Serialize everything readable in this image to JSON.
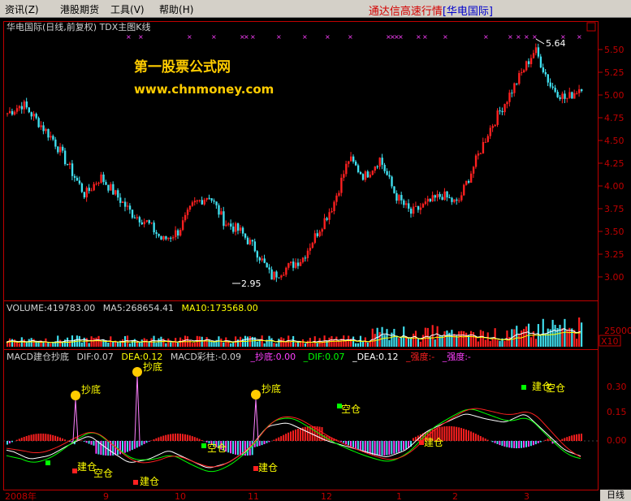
{
  "menu": {
    "items": [
      "资讯",
      "港股期货",
      "工具",
      "帮助"
    ],
    "hotkeys": [
      "(Z)",
      "",
      "(V)",
      "(H)"
    ]
  },
  "app_title": {
    "prefix": "通达信高速行情",
    "stock": "[华电国际]"
  },
  "kline": {
    "header": "华电国际(日线,前复权) TDX主图K线",
    "watermark_line1": "第一股票公式网",
    "watermark_line2": "www.chnmoney.com",
    "high_label": "5.64",
    "low_label": "2.95",
    "y_ticks": [
      "5.50",
      "5.25",
      "5.00",
      "4.75",
      "4.50",
      "4.25",
      "4.00",
      "3.75",
      "3.50",
      "3.25",
      "3.00"
    ]
  },
  "volume": {
    "label_volume": "VOLUME:419783.00",
    "label_ma5": "MA5:268654.41",
    "label_ma10": "MA10:173568.00",
    "y_tick": "25000",
    "unit": "X10"
  },
  "macd": {
    "name": "MACD建仓抄底",
    "dif": "DIF:0.07",
    "dea": "DEA:0.12",
    "macd_bar": "MACD彩柱:-0.09",
    "chaodi": "_抄底:0.00",
    "dif2": "_DIF:0.07",
    "dea2": "_DEA:0.12",
    "qiangdu1": "_强度:-",
    "qiangdu2": "_强度:-",
    "y_ticks": [
      "0.30",
      "0.15",
      "0.00"
    ],
    "signal_chaodi": "抄底",
    "signal_jiancang": "建仓",
    "signal_kongcang": "空仓"
  },
  "time_axis": {
    "labels": [
      "2008年",
      "9",
      "10",
      "11",
      "12",
      "1",
      "2",
      "3"
    ],
    "period": "日线"
  },
  "colors": {
    "up": "#ff2020",
    "down": "#40e0f0",
    "axis": "#c00000",
    "ma5": "#ffffff",
    "ma10": "#ffff00",
    "dif": "#ffffff",
    "dea": "#00ff00",
    "signal": "#ffff00"
  },
  "chart_data": {
    "type": "candlestick",
    "series": [
      {
        "name": "K线",
        "close_trend": [
          4.8,
          4.9,
          4.7,
          4.5,
          4.2,
          3.9,
          4.1,
          3.9,
          3.7,
          3.6,
          3.4,
          3.5,
          3.8,
          3.9,
          3.6,
          3.5,
          3.3,
          3.0,
          3.1,
          3.2,
          3.5,
          3.8,
          4.3,
          4.1,
          4.3,
          3.9,
          3.7,
          3.8,
          3.9,
          3.8,
          4.2,
          4.6,
          4.9,
          5.2,
          5.5,
          5.1,
          4.95,
          5.1
        ]
      },
      {
        "name": "MACD",
        "values": [
          -0.05,
          -0.1,
          -0.08,
          -0.02,
          0.03,
          -0.05,
          -0.12,
          -0.1,
          -0.05,
          -0.1,
          -0.15,
          -0.12,
          -0.05,
          0.08,
          0.1,
          0.05,
          0.0,
          -0.03,
          -0.06,
          -0.09,
          -0.05,
          0.05,
          0.1,
          0.15,
          0.12,
          0.1,
          0.15,
          0.05,
          -0.05,
          -0.09
        ]
      }
    ],
    "y_range_price": [
      2.85,
      5.7
    ],
    "y_range_macd": [
      -0.15,
      0.4
    ],
    "high": 5.64,
    "low": 2.95
  }
}
